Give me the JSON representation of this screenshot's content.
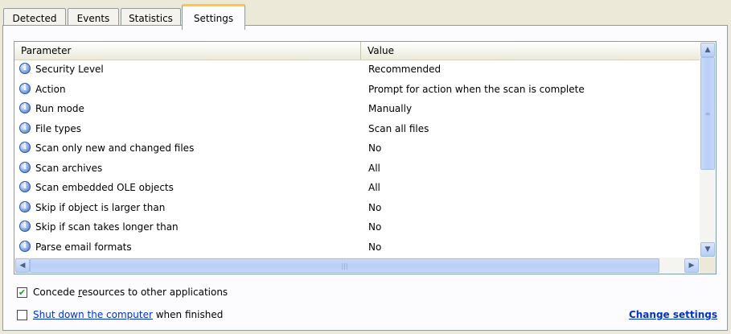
{
  "tabs": [
    {
      "label": "Detected"
    },
    {
      "label": "Events"
    },
    {
      "label": "Statistics"
    },
    {
      "label": "Settings"
    }
  ],
  "table": {
    "columns": {
      "parameter": "Parameter",
      "value": "Value"
    },
    "rows": [
      {
        "param": "Security Level",
        "value": "Recommended"
      },
      {
        "param": "Action",
        "value": "Prompt for action when the scan is complete"
      },
      {
        "param": "Run mode",
        "value": "Manually"
      },
      {
        "param": "File types",
        "value": "Scan all files"
      },
      {
        "param": "Scan only new and changed files",
        "value": "No"
      },
      {
        "param": "Scan archives",
        "value": "All"
      },
      {
        "param": "Scan embedded OLE objects",
        "value": "All"
      },
      {
        "param": "Skip if object is larger than",
        "value": "No"
      },
      {
        "param": "Skip if scan takes longer than",
        "value": "No"
      },
      {
        "param": "Parse email formats",
        "value": "No"
      }
    ],
    "row_icon": "info-icon"
  },
  "options": {
    "concede": {
      "checked": true,
      "check_mark": "✔",
      "label_pre": "Concede ",
      "label_access": "r",
      "label_post": "esources to other applications"
    },
    "shutdown": {
      "checked": false,
      "link_text": "Shut down the computer",
      "label_post": " when finished"
    }
  },
  "change_settings": "Change settings",
  "scrollbar_glyphs": {
    "up": "▲",
    "down": "▼",
    "left": "◀",
    "right": "▶",
    "grip_v": "≡",
    "grip_h": "|||"
  }
}
